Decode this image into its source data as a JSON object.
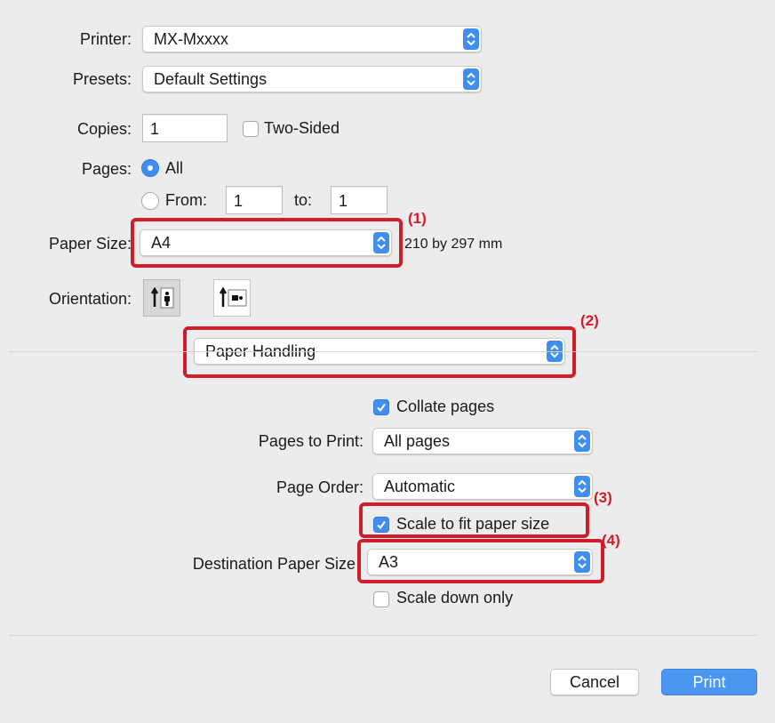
{
  "dialog": {
    "printer": {
      "label": "Printer:",
      "value": "MX-Mxxxx"
    },
    "presets": {
      "label": "Presets:",
      "value": "Default Settings"
    },
    "copies": {
      "label": "Copies:",
      "value": "1",
      "two_sided_label": "Two-Sided",
      "two_sided_checked": false
    },
    "pages": {
      "label": "Pages:",
      "all_label": "All",
      "all_selected": true,
      "from_label": "From:",
      "from_value": "1",
      "to_label": "to:",
      "to_value": "1"
    },
    "paper_size": {
      "label": "Paper Size:",
      "value": "A4",
      "dimensions": "210 by 297 mm"
    },
    "orientation": {
      "label": "Orientation:",
      "selected": "portrait",
      "options": [
        "portrait",
        "landscape"
      ]
    },
    "section_menu": {
      "value": "Paper Handling"
    },
    "paper_handling": {
      "collate_label": "Collate pages",
      "collate_checked": true,
      "pages_to_print_label": "Pages to Print:",
      "pages_to_print_value": "All pages",
      "page_order_label": "Page Order:",
      "page_order_value": "Automatic",
      "scale_to_fit_label": "Scale to fit paper size",
      "scale_to_fit_checked": true,
      "destination_paper_size_label": "Destination Paper Size",
      "destination_paper_size_value": "A3",
      "scale_down_only_label": "Scale down only",
      "scale_down_only_checked": false
    },
    "buttons": {
      "cancel": "Cancel",
      "print": "Print"
    }
  },
  "callouts": {
    "c1": "(1)",
    "c2": "(2)",
    "c3": "(3)",
    "c4": "(4)"
  },
  "colors": {
    "accent": "#3f8ef0",
    "callout_red": "#d01c2b",
    "background": "#ececec"
  },
  "icons": {
    "stepper": "up-down-chevron-icon",
    "check": "checkmark-icon"
  }
}
